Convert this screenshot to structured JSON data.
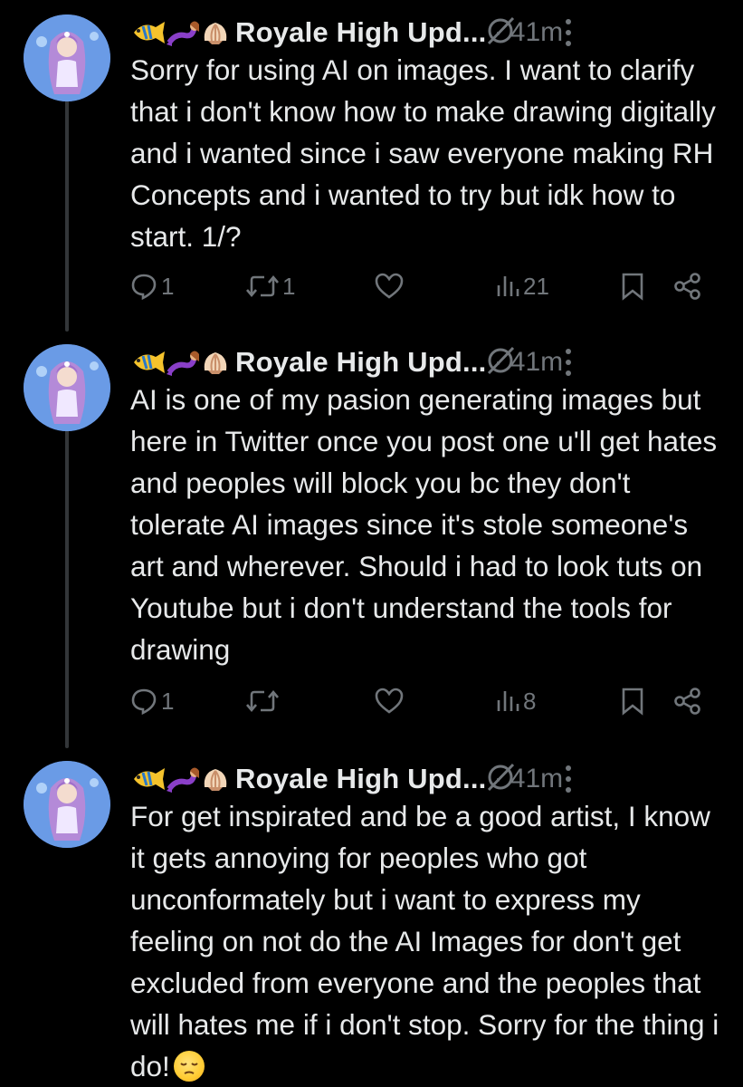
{
  "tweets": [
    {
      "author_name": "Royale High Upd...",
      "time": "· 41m",
      "text": "Sorry for using AI on images. I want to clarify that i don't know how to make drawing digitally and i wanted since i saw everyone making RH Concepts and i wanted to try but idk how to start. 1/?",
      "replies": "1",
      "reposts": "1",
      "likes": "",
      "views": "21"
    },
    {
      "author_name": "Royale High Upd...",
      "time": "· 41m",
      "text": "AI is one of my pasion generating images but here in Twitter once you post one u'll get hates and peoples will block you bc they don't tolerate AI images since it's stole someone's art and wherever. Should i had to look tuts on Youtube but i don't understand the tools for drawing",
      "replies": "1",
      "reposts": "",
      "likes": "",
      "views": "8"
    },
    {
      "author_name": "Royale High Upd...",
      "time": "· 41m",
      "text": "For get inspirated and be a good artist, I know it gets annoying for peoples who got unconformately but i want to express my feeling on not do the AI Images for don't get excluded from everyone and the peoples that will hates me if i don't stop. Sorry for the thing i do!",
      "replies": "",
      "reposts": "",
      "likes": "",
      "views": ""
    }
  ],
  "icons": {
    "name_emojis": [
      "fish-emoji",
      "mermaid-emoji",
      "shell-emoji"
    ],
    "grok": "grok-icon",
    "more": "more-icon",
    "reply": "reply-icon",
    "repost": "repost-icon",
    "like": "heart-icon",
    "views": "views-icon",
    "bookmark": "bookmark-icon",
    "share": "share-icon",
    "trailing_emoji": "pensive-face-emoji"
  },
  "colors": {
    "background": "#000000",
    "text": "#e7e9ea",
    "muted": "#71767b",
    "thread_line": "#333639"
  }
}
